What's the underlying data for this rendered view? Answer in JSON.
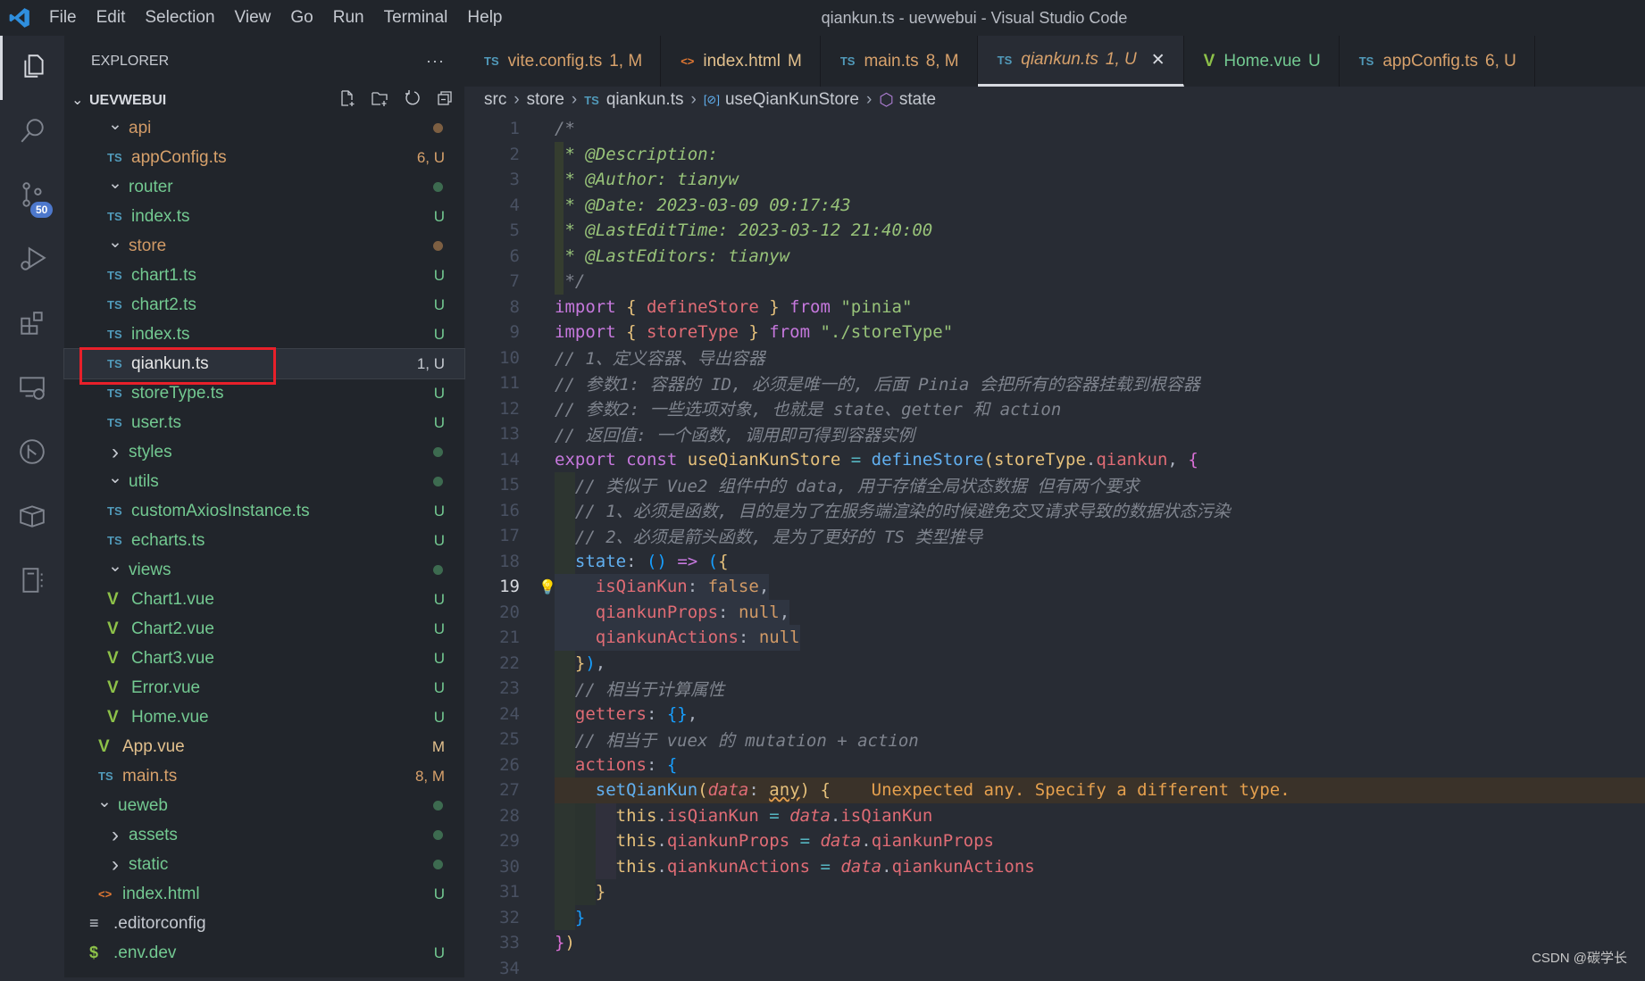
{
  "window": {
    "title": "qiankun.ts - uevwebui - Visual Studio Code",
    "menu": [
      "File",
      "Edit",
      "Selection",
      "View",
      "Go",
      "Run",
      "Terminal",
      "Help"
    ]
  },
  "activity_bar": [
    {
      "icon": "explorer-icon",
      "active": true
    },
    {
      "icon": "search-icon"
    },
    {
      "icon": "source-control-icon",
      "badge": "50"
    },
    {
      "icon": "run-debug-icon"
    },
    {
      "icon": "extensions-icon"
    },
    {
      "icon": "remote-explorer-icon"
    },
    {
      "icon": "git-graph-icon"
    },
    {
      "icon": "package-icon"
    },
    {
      "icon": "notebook-icon"
    }
  ],
  "sidebar": {
    "title": "EXPLORER",
    "more": "···",
    "root": "UEVWEBUI",
    "tree": [
      {
        "name": "api",
        "type": "folder",
        "depth": 1,
        "open": true,
        "color": "#d19a66",
        "dot": "#7d5f42"
      },
      {
        "name": "appConfig.ts",
        "type": "ts",
        "depth": 2,
        "color": "#d7a16b",
        "badge": "6, U"
      },
      {
        "name": "router",
        "type": "folder",
        "depth": 1,
        "open": true,
        "color": "#73c991",
        "dot": "#3d6b50"
      },
      {
        "name": "index.ts",
        "type": "ts",
        "depth": 2,
        "color": "#73c991",
        "badge": "U"
      },
      {
        "name": "store",
        "type": "folder",
        "depth": 1,
        "open": true,
        "color": "#d19a66",
        "dot": "#7d5f42"
      },
      {
        "name": "chart1.ts",
        "type": "ts",
        "depth": 2,
        "color": "#73c991",
        "badge": "U"
      },
      {
        "name": "chart2.ts",
        "type": "ts",
        "depth": 2,
        "color": "#73c991",
        "badge": "U"
      },
      {
        "name": "index.ts",
        "type": "ts",
        "depth": 2,
        "color": "#73c991",
        "badge": "U"
      },
      {
        "name": "qiankun.ts",
        "type": "ts",
        "depth": 2,
        "color": "#e6e6e6",
        "badge": "1, U",
        "selected": true
      },
      {
        "name": "storeType.ts",
        "type": "ts",
        "depth": 2,
        "color": "#73c991",
        "badge": "U"
      },
      {
        "name": "user.ts",
        "type": "ts",
        "depth": 2,
        "color": "#73c991",
        "badge": "U"
      },
      {
        "name": "styles",
        "type": "folder",
        "depth": 1,
        "open": false,
        "color": "#73c991",
        "dot": "#3d6b50"
      },
      {
        "name": "utils",
        "type": "folder",
        "depth": 1,
        "open": true,
        "color": "#73c991",
        "dot": "#3d6b50"
      },
      {
        "name": "customAxiosInstance.ts",
        "type": "ts",
        "depth": 2,
        "color": "#73c991",
        "badge": "U"
      },
      {
        "name": "echarts.ts",
        "type": "ts",
        "depth": 2,
        "color": "#73c991",
        "badge": "U"
      },
      {
        "name": "views",
        "type": "folder",
        "depth": 1,
        "open": true,
        "color": "#73c991",
        "dot": "#3d6b50"
      },
      {
        "name": "Chart1.vue",
        "type": "vue",
        "depth": 2,
        "color": "#73c991",
        "badge": "U"
      },
      {
        "name": "Chart2.vue",
        "type": "vue",
        "depth": 2,
        "color": "#73c991",
        "badge": "U"
      },
      {
        "name": "Chart3.vue",
        "type": "vue",
        "depth": 2,
        "color": "#73c991",
        "badge": "U"
      },
      {
        "name": "Error.vue",
        "type": "vue",
        "depth": 2,
        "color": "#73c991",
        "badge": "U"
      },
      {
        "name": "Home.vue",
        "type": "vue",
        "depth": 2,
        "color": "#73c991",
        "badge": "U"
      },
      {
        "name": "App.vue",
        "type": "vue",
        "depth": 1,
        "color": "#e2c08d",
        "badge": "M"
      },
      {
        "name": "main.ts",
        "type": "ts",
        "depth": 1,
        "color": "#d7a16b",
        "badge": "8, M"
      },
      {
        "name": "ueweb",
        "type": "folder",
        "depth": 0,
        "open": true,
        "color": "#73c991",
        "dot": "#3d6b50"
      },
      {
        "name": "assets",
        "type": "folder",
        "depth": 1,
        "open": false,
        "color": "#73c991",
        "dot": "#3d6b50"
      },
      {
        "name": "static",
        "type": "folder",
        "depth": 1,
        "open": false,
        "color": "#73c991",
        "dot": "#3d6b50"
      },
      {
        "name": "index.html",
        "type": "html",
        "depth": 1,
        "color": "#73c991",
        "badge": "U"
      },
      {
        "name": ".editorconfig",
        "type": "config",
        "depth": 0,
        "color": "#c5c9d0"
      },
      {
        "name": ".env.dev",
        "type": "env",
        "depth": 0,
        "color": "#73c991",
        "badge": "U"
      }
    ]
  },
  "tabs": [
    {
      "icon": "TS",
      "label": "vite.config.ts",
      "status": "1, M",
      "color": "#d7a16b"
    },
    {
      "icon": "<>",
      "label": "index.html",
      "status": "M",
      "color": "#e2c08d"
    },
    {
      "icon": "TS",
      "label": "main.ts",
      "status": "8, M",
      "color": "#d7a16b"
    },
    {
      "icon": "TS",
      "label": "qiankun.ts",
      "status": "1, U",
      "color": "#d7a16b",
      "active": true,
      "close": "✕"
    },
    {
      "icon": "V",
      "label": "Home.vue",
      "status": "U",
      "color": "#73c991"
    },
    {
      "icon": "TS",
      "label": "appConfig.ts",
      "status": "6, U",
      "color": "#d7a16b"
    }
  ],
  "breadcrumb": [
    "src",
    "store",
    "qiankun.ts",
    "useQianKunStore",
    "state"
  ],
  "editor": {
    "current_line": 19,
    "lines": [
      [
        [
          "cm",
          "/*"
        ]
      ],
      [
        [
          "dc",
          " * @Description:"
        ]
      ],
      [
        [
          "dc",
          " * @Author: tianyw"
        ]
      ],
      [
        [
          "dc",
          " * @Date: 2023-03-09 09:17:43"
        ]
      ],
      [
        [
          "dc",
          " * @LastEditTime: 2023-03-12 21:40:00"
        ]
      ],
      [
        [
          "dc",
          " * @LastEditors: tianyw"
        ]
      ],
      [
        [
          "cm",
          " */"
        ]
      ],
      [
        [
          "kw",
          "import "
        ],
        [
          "b1",
          "{ "
        ],
        [
          "vr",
          "defineStore"
        ],
        [
          "b1",
          " } "
        ],
        [
          "kw",
          "from "
        ],
        [
          "st",
          "\"pinia\""
        ]
      ],
      [
        [
          "kw",
          "import "
        ],
        [
          "b1",
          "{ "
        ],
        [
          "vr",
          "storeType"
        ],
        [
          "b1",
          " } "
        ],
        [
          "kw",
          "from "
        ],
        [
          "st",
          "\"./storeType\""
        ]
      ],
      [
        [
          "cm",
          "// 1、定义容器、导出容器"
        ]
      ],
      [
        [
          "cm",
          "// 参数1: 容器的 ID, 必须是唯一的, 后面 Pinia 会把所有的容器挂载到根容器"
        ]
      ],
      [
        [
          "cm",
          "// 参数2: 一些选项对象, 也就是 state、getter 和 action"
        ]
      ],
      [
        [
          "cm",
          "// 返回值: 一个函数, 调用即可得到容器实例"
        ]
      ],
      [
        [
          "kw",
          "export const "
        ],
        [
          "ty",
          "useQianKunStore "
        ],
        [
          "op",
          "= "
        ],
        [
          "fn",
          "defineStore"
        ],
        [
          "b1",
          "("
        ],
        [
          "ty",
          "storeType"
        ],
        [
          "pn",
          "."
        ],
        [
          "vr",
          "qiankun"
        ],
        [
          "pn",
          ", "
        ],
        [
          "b2",
          "{"
        ]
      ],
      [
        [
          "cm",
          "  // 类似于 Vue2 组件中的 data, 用于存储全局状态数据 但有两个要求"
        ]
      ],
      [
        [
          "cm",
          "  // 1、必须是函数, 目的是为了在服务端渲染的时候避免交叉请求导致的数据状态污染"
        ]
      ],
      [
        [
          "cm",
          "  // 2、必须是箭头函数, 是为了更好的 TS 类型推导"
        ]
      ],
      [
        [
          "pn",
          "  "
        ],
        [
          "fn",
          "state"
        ],
        [
          "pn",
          ": "
        ],
        [
          "b3",
          "() "
        ],
        [
          "kw",
          "=> "
        ],
        [
          "b3",
          "("
        ],
        [
          "b1",
          "{"
        ]
      ],
      [
        [
          "pn",
          "    "
        ],
        [
          "vr",
          "isQianKun"
        ],
        [
          "pn",
          ": "
        ],
        [
          "nm",
          "false"
        ],
        [
          "pn",
          ","
        ]
      ],
      [
        [
          "pn",
          "    "
        ],
        [
          "vr",
          "qiankunProps"
        ],
        [
          "pn",
          ": "
        ],
        [
          "nm",
          "null"
        ],
        [
          "pn",
          ","
        ]
      ],
      [
        [
          "pn",
          "    "
        ],
        [
          "vr",
          "qiankunActions"
        ],
        [
          "pn",
          ": "
        ],
        [
          "nm",
          "null"
        ]
      ],
      [
        [
          "b1",
          "  }"
        ],
        [
          "b3",
          ")"
        ],
        [
          "pn",
          ","
        ]
      ],
      [
        [
          "cm",
          "  // 相当于计算属性"
        ]
      ],
      [
        [
          "pn",
          "  "
        ],
        [
          "vr",
          "getters"
        ],
        [
          "pn",
          ": "
        ],
        [
          "b3",
          "{}"
        ],
        [
          "pn",
          ","
        ]
      ],
      [
        [
          "cm",
          "  // 相当于 vuex 的 mutation + action"
        ]
      ],
      [
        [
          "pn",
          "  "
        ],
        [
          "vr",
          "actions"
        ],
        [
          "pn",
          ": "
        ],
        [
          "b3",
          "{"
        ]
      ],
      [
        [
          "pn",
          "    "
        ],
        [
          "fn",
          "setQianKun"
        ],
        [
          "b1",
          "("
        ],
        [
          "pa",
          "data"
        ],
        [
          "pn",
          ": "
        ],
        [
          "ty und",
          "any"
        ],
        [
          "b1",
          ") {"
        ],
        [
          "wn",
          "    Unexpected any. Specify a different type."
        ]
      ],
      [
        [
          "pn",
          "      "
        ],
        [
          "ty",
          "this"
        ],
        [
          "pn",
          "."
        ],
        [
          "vr",
          "isQianKun "
        ],
        [
          "op",
          "= "
        ],
        [
          "pa",
          "data"
        ],
        [
          "pn",
          "."
        ],
        [
          "vr",
          "isQianKun"
        ]
      ],
      [
        [
          "pn",
          "      "
        ],
        [
          "ty",
          "this"
        ],
        [
          "pn",
          "."
        ],
        [
          "vr",
          "qiankunProps "
        ],
        [
          "op",
          "= "
        ],
        [
          "pa",
          "data"
        ],
        [
          "pn",
          "."
        ],
        [
          "vr",
          "qiankunProps"
        ]
      ],
      [
        [
          "pn",
          "      "
        ],
        [
          "ty",
          "this"
        ],
        [
          "pn",
          "."
        ],
        [
          "vr",
          "qiankunActions "
        ],
        [
          "op",
          "= "
        ],
        [
          "pa",
          "data"
        ],
        [
          "pn",
          "."
        ],
        [
          "vr",
          "qiankunActions"
        ]
      ],
      [
        [
          "b1",
          "    }"
        ]
      ],
      [
        [
          "b3",
          "  }"
        ]
      ],
      [
        [
          "b2",
          "}"
        ],
        [
          "b1",
          ")"
        ]
      ],
      [
        [
          "pn",
          ""
        ]
      ]
    ]
  },
  "watermark": "CSDN @碳学长"
}
